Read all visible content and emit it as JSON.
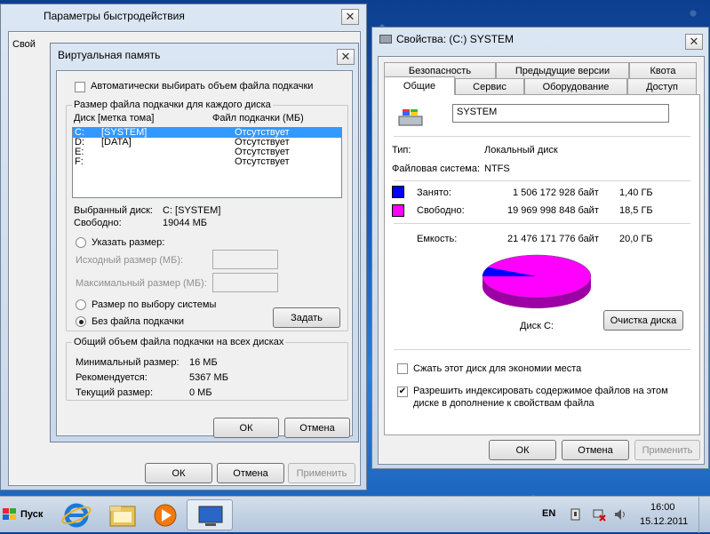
{
  "perf": {
    "title": "Параметры быстродействия",
    "partial_tab": "Свой",
    "ok": "ОК",
    "cancel": "Отмена",
    "apply": "Применить"
  },
  "vm": {
    "title": "Виртуальная память",
    "auto_label": "Автоматически выбирать объем файла подкачки",
    "group1_title": "Размер файла подкачки для каждого диска",
    "col_disk": "Диск [метка тома]",
    "col_file": "Файл подкачки (МБ)",
    "drives": [
      {
        "letter": "C:",
        "label": "[SYSTEM]",
        "status": "Отсутствует"
      },
      {
        "letter": "D:",
        "label": "[DATA]",
        "status": "Отсутствует"
      },
      {
        "letter": "E:",
        "label": "",
        "status": "Отсутствует"
      },
      {
        "letter": "F:",
        "label": "",
        "status": "Отсутствует"
      }
    ],
    "selected_disk_label": "Выбранный диск:",
    "selected_disk_value": "C:  [SYSTEM]",
    "free_label": "Свободно:",
    "free_value": "19044 МБ",
    "custom_size": "Указать размер:",
    "initial_size": "Исходный размер (МБ):",
    "max_size": "Максимальный размер (МБ):",
    "system_managed": "Размер по выбору системы",
    "no_paging": "Без файла подкачки",
    "set_button": "Задать",
    "group2_title": "Общий объем файла подкачки на всех дисках",
    "min_label": "Минимальный размер:",
    "min_value": "16 МБ",
    "rec_label": "Рекомендуется:",
    "rec_value": "5367 МБ",
    "cur_label": "Текущий размер:",
    "cur_value": "0 МБ",
    "ok": "ОК",
    "cancel": "Отмена"
  },
  "props": {
    "title": "Свойства: (C:) SYSTEM",
    "tabs_row1": [
      "Безопасность",
      "Предыдущие версии",
      "Квота"
    ],
    "tabs_row2": [
      "Общие",
      "Сервис",
      "Оборудование",
      "Доступ"
    ],
    "name_value": "SYSTEM",
    "type_label": "Тип:",
    "type_value": "Локальный диск",
    "fs_label": "Файловая система:",
    "fs_value": "NTFS",
    "used_label": "Занято:",
    "used_bytes": "1 506 172 928 байт",
    "used_gb": "1,40 ГБ",
    "free_label": "Свободно:",
    "free_bytes": "19 969 998 848 байт",
    "free_gb": "18,5 ГБ",
    "cap_label": "Емкость:",
    "cap_bytes": "21 476 171 776 байт",
    "cap_gb": "20,0 ГБ",
    "disk_label": "Диск C:",
    "cleanup_button": "Очистка диска",
    "compress_label": "Сжать этот диск для экономии места",
    "index_label_line1": "Разрешить индексировать содержимое файлов на этом",
    "index_label_line2": "диске в дополнение к свойствам файла",
    "used_color": "#0000ff",
    "free_color": "#ff00ff",
    "used_fraction": 0.0701,
    "ok": "ОК",
    "cancel": "Отмена",
    "apply": "Применить"
  },
  "taskbar": {
    "start_label": "Пуск",
    "lang": "EN",
    "time": "16:00",
    "date": "15.12.2011"
  }
}
